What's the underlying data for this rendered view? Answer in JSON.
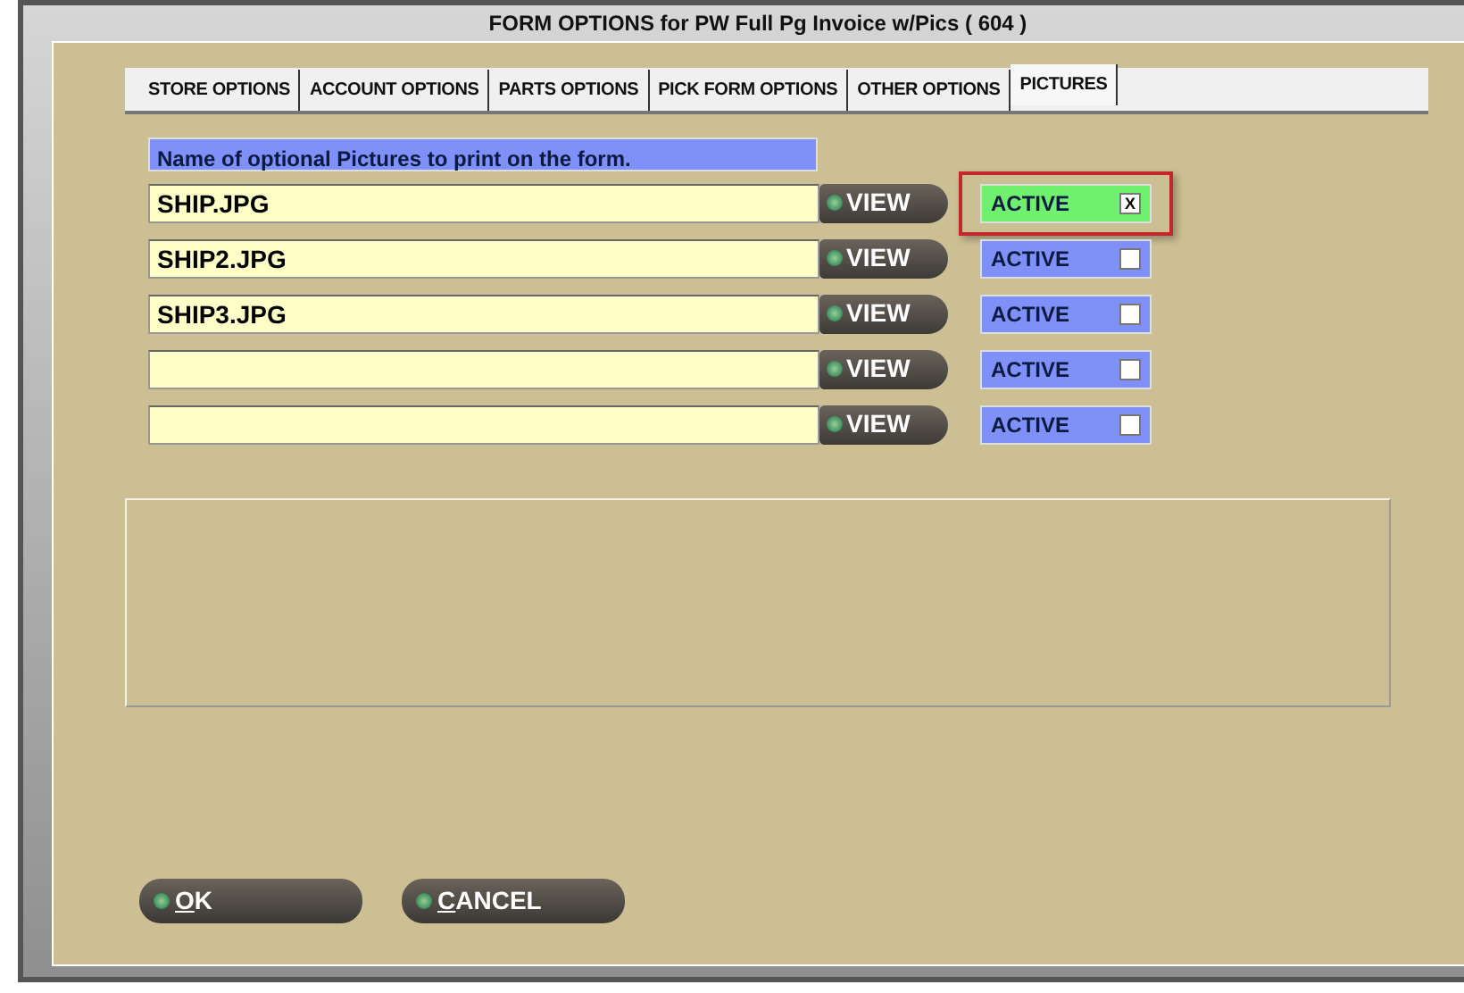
{
  "window": {
    "title": "FORM OPTIONS for PW Full Pg Invoice w/Pics ( 604 )"
  },
  "tabs": [
    {
      "label": "STORE OPTIONS",
      "selected": false
    },
    {
      "label": "ACCOUNT OPTIONS",
      "selected": false
    },
    {
      "label": "PARTS OPTIONS",
      "selected": false
    },
    {
      "label": "PICK FORM OPTIONS",
      "selected": false
    },
    {
      "label": "OTHER OPTIONS",
      "selected": false
    },
    {
      "label": "PICTURES",
      "selected": true
    }
  ],
  "pictures": {
    "heading": "Name of optional Pictures to print on the form.",
    "rows": [
      {
        "value": "SHIP.JPG",
        "view": "VIEW",
        "active_label": "ACTIVE",
        "checked": true,
        "check_mark": "X",
        "highlighted": true
      },
      {
        "value": "SHIP2.JPG",
        "view": "VIEW",
        "active_label": "ACTIVE",
        "checked": false,
        "highlighted": false
      },
      {
        "value": "SHIP3.JPG",
        "view": "VIEW",
        "active_label": "ACTIVE",
        "checked": false,
        "highlighted": false
      },
      {
        "value": "",
        "view": "VIEW",
        "active_label": "ACTIVE",
        "checked": false,
        "highlighted": false
      },
      {
        "value": "",
        "view": "VIEW",
        "active_label": "ACTIVE",
        "checked": false,
        "highlighted": false
      }
    ]
  },
  "buttons": [
    {
      "label": "OK",
      "underline_first": true
    },
    {
      "label": "CANCEL",
      "underline_first": true
    }
  ]
}
